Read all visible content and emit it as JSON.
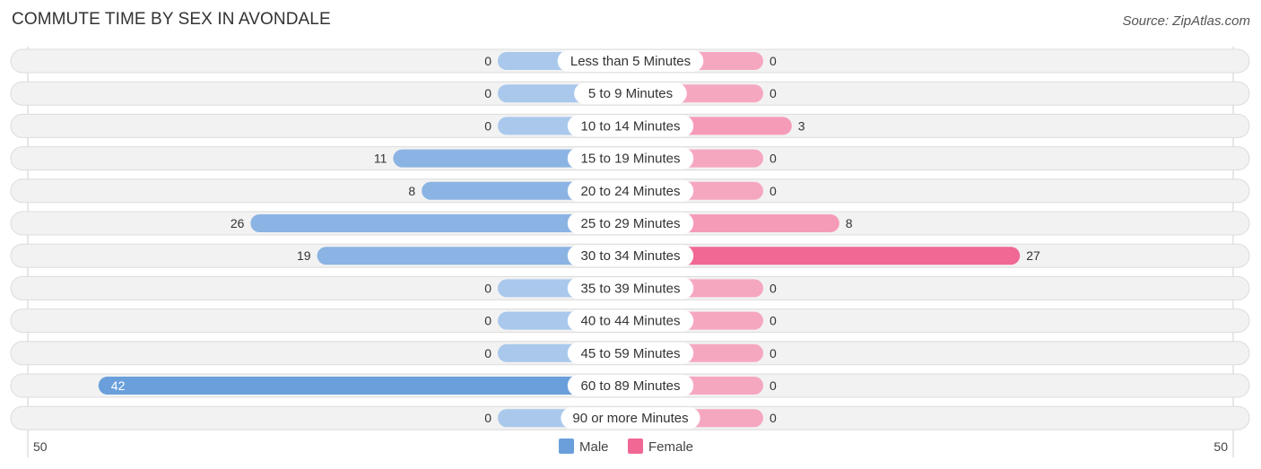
{
  "header": {
    "title": "COMMUTE TIME BY SEX IN AVONDALE",
    "source": "Source: ZipAtlas.com"
  },
  "chart_data": {
    "type": "bar",
    "orientation": "horizontal-diverging",
    "title": "COMMUTE TIME BY SEX IN AVONDALE",
    "categories": [
      "Less than 5 Minutes",
      "5 to 9 Minutes",
      "10 to 14 Minutes",
      "15 to 19 Minutes",
      "20 to 24 Minutes",
      "25 to 29 Minutes",
      "30 to 34 Minutes",
      "35 to 39 Minutes",
      "40 to 44 Minutes",
      "45 to 59 Minutes",
      "60 to 89 Minutes",
      "90 or more Minutes"
    ],
    "series": [
      {
        "name": "Male",
        "color": "#6a9fdc",
        "light_color": "#a9c8ec",
        "side": "left",
        "values": [
          0,
          0,
          0,
          11,
          8,
          26,
          19,
          0,
          0,
          0,
          42,
          0
        ]
      },
      {
        "name": "Female",
        "color": "#f06893",
        "light_color": "#f6a7c0",
        "side": "right",
        "values": [
          0,
          0,
          3,
          0,
          0,
          8,
          27,
          0,
          0,
          0,
          0,
          0
        ]
      }
    ],
    "axis": {
      "left_max_label": "50",
      "right_max_label": "50",
      "max": 50
    },
    "legend": {
      "placement": "bottom-center",
      "entries": [
        "Male",
        "Female"
      ]
    },
    "grid": false
  }
}
